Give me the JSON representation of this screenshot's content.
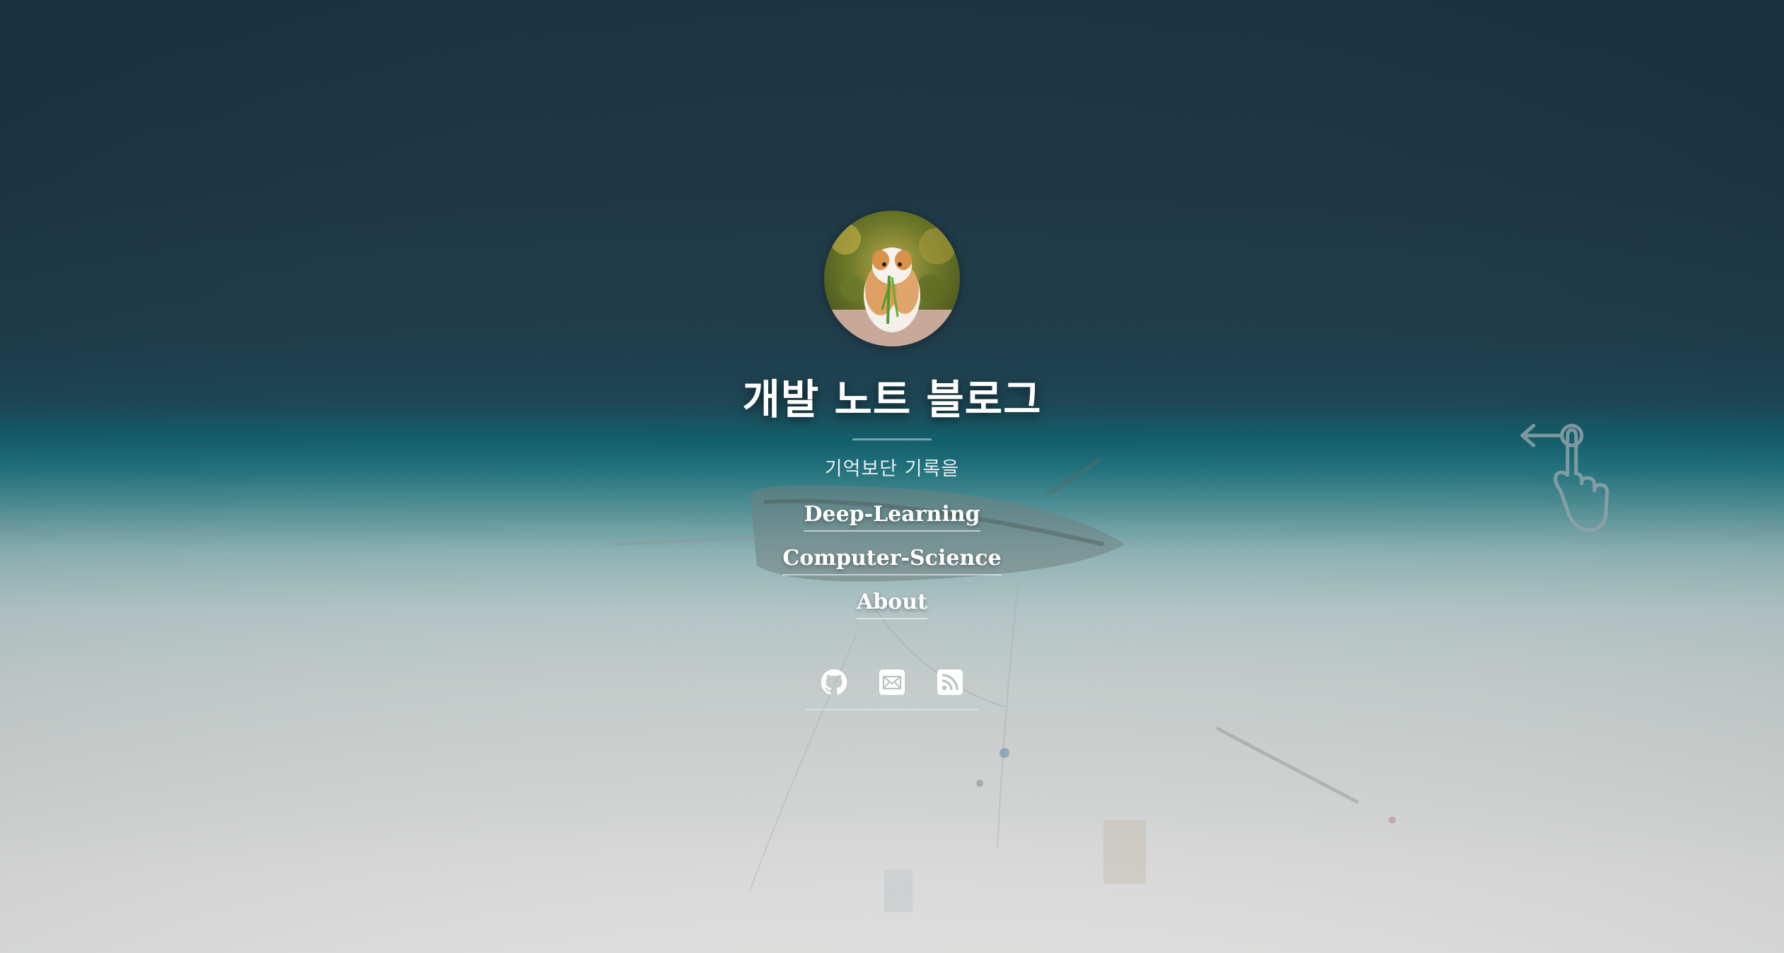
{
  "site": {
    "title": "개발 노트 블로그",
    "subtitle": "기억보단 기록을"
  },
  "avatar": {
    "alt": "guinea pig avatar"
  },
  "nav": {
    "items": [
      {
        "label": "Deep-Learning"
      },
      {
        "label": "Computer-Science"
      },
      {
        "label": "About"
      }
    ]
  },
  "social": {
    "icons": [
      "github-icon",
      "mail-icon",
      "rss-icon"
    ]
  },
  "hint": {
    "icon": "swipe-left-hand-icon"
  },
  "colors": {
    "title": "#ffffff",
    "subtitle": "#e8eef0",
    "sea_dark": "#1b3442",
    "sea_teal": "#0f5c68",
    "sand": "#e2e2e1"
  }
}
